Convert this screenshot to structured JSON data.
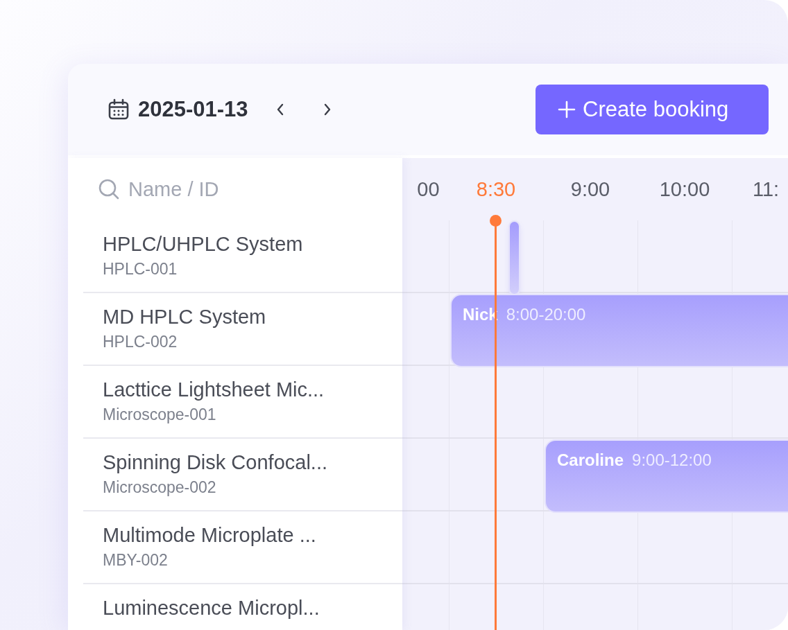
{
  "date": "2025-01-13",
  "create_button": "Create booking",
  "search": {
    "placeholder": "Name / ID"
  },
  "time_labels": [
    {
      "label": "00",
      "current": false
    },
    {
      "label": "8:30",
      "current": true
    },
    {
      "label": "9:00",
      "current": false
    },
    {
      "label": "10:00",
      "current": false
    },
    {
      "label": "11:",
      "current": false
    }
  ],
  "resources": [
    {
      "name": "HPLC/UHPLC System",
      "id": "HPLC-001",
      "booking": {
        "kind": "compact"
      }
    },
    {
      "name": "MD HPLC System",
      "id": "HPLC-002",
      "booking": {
        "kind": "full",
        "person": "Nick",
        "time": "8:00-20:00"
      }
    },
    {
      "name": "Lacttice Lightsheet Mic...",
      "id": "Microscope-001"
    },
    {
      "name": "Spinning Disk Confocal...",
      "id": "Microscope-002",
      "booking": {
        "kind": "full",
        "person": "Caroline",
        "time": "9:00-12:00"
      }
    },
    {
      "name": "Multimode Microplate ...",
      "id": "MBY-002"
    },
    {
      "name": "Luminescence Micropl..."
    }
  ]
}
